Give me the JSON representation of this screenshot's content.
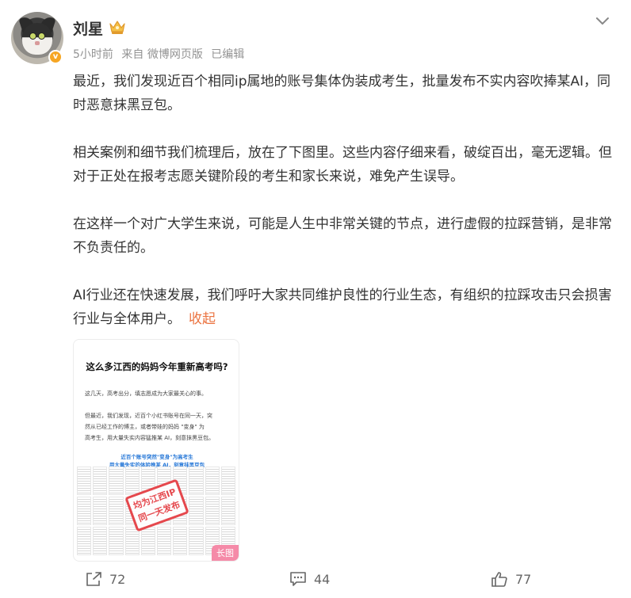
{
  "user": {
    "name": "刘星",
    "verify_badge": "v"
  },
  "meta": {
    "time": "5小时前",
    "source": "来自 微博网页版",
    "edited": "已编辑"
  },
  "post": {
    "paragraphs": [
      "最近，我们发现近百个相同ip属地的账号集体伪装成考生，批量发布不实内容吹捧某AI，同时恶意抹黑豆包。",
      "相关案例和细节我们梳理后，放在了下图里。这些内容仔细来看，破绽百出，毫无逻辑。但对于正处在报考志愿关键阶段的考生和家长来说，难免产生误导。",
      "在这样一个对广大学生来说，可能是人生中非常关键的节点，进行虚假的拉踩营销，是非常不负责任的。",
      "AI行业还在快速发展，我们呼吁大家共同维护良性的行业生态，有组织的拉踩攻击只会损害行业与全体用户。"
    ],
    "collapse_label": "收起"
  },
  "image": {
    "title": "这么多江西的妈妈今年重新高考吗?",
    "line1": "这几天，高考出分，填志愿成为大家最关心的事。",
    "line2": "但最近，我们发现，近百个小红书账号在同一天，突",
    "line3": "然从已经工作的博主，或者带娃的妈妈 \"变身\" 为",
    "line4": "高考生，用大量失实内容猛推某 AI，刻意抹黑豆包。",
    "blue1": "近百个账号突然\"变身\"为高考生",
    "blue2": "用大量失实的体验推某 AI，刻意抹黑豆包",
    "stamp_line1": "均为江西IP",
    "stamp_line2": "同一天发布",
    "long_tag": "长图"
  },
  "actions": {
    "share_count": "72",
    "comment_count": "44",
    "like_count": "77"
  },
  "colors": {
    "accent": "#eb7340",
    "verify": "#f6a623",
    "stamp": "#e5484d",
    "long_tag": "#f58aa8"
  }
}
